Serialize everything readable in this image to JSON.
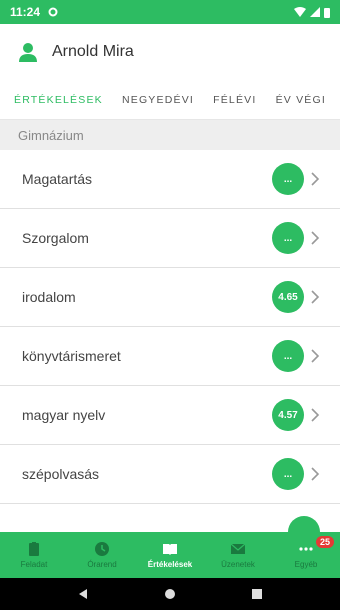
{
  "status_bar": {
    "time": "11:24"
  },
  "user": {
    "name": "Arnold Mira"
  },
  "tabs": [
    {
      "label": "Értékelések",
      "active": true
    },
    {
      "label": "Negyedévi",
      "active": false
    },
    {
      "label": "Félévi",
      "active": false
    },
    {
      "label": "Év végi",
      "active": false
    }
  ],
  "section": {
    "title": "Gimnázium"
  },
  "items": [
    {
      "label": "Magatartás",
      "badge": "..."
    },
    {
      "label": "Szorgalom",
      "badge": "..."
    },
    {
      "label": "irodalom",
      "badge": "4.65"
    },
    {
      "label": "könyvtárismeret",
      "badge": "..."
    },
    {
      "label": "magyar nyelv",
      "badge": "4.57"
    },
    {
      "label": "szépolvasás",
      "badge": "..."
    }
  ],
  "bottom_nav": [
    {
      "label": "Feladat",
      "icon": "clipboard-icon",
      "active": false
    },
    {
      "label": "Órarend",
      "icon": "clock-icon",
      "active": false
    },
    {
      "label": "Értékelések",
      "icon": "book-icon",
      "active": true
    },
    {
      "label": "Üzenetek",
      "icon": "mail-icon",
      "active": false
    },
    {
      "label": "Egyéb",
      "icon": "more-icon",
      "active": false,
      "badge": "25"
    }
  ],
  "colors": {
    "accent": "#2dbc62",
    "badge_red": "#e53935"
  }
}
